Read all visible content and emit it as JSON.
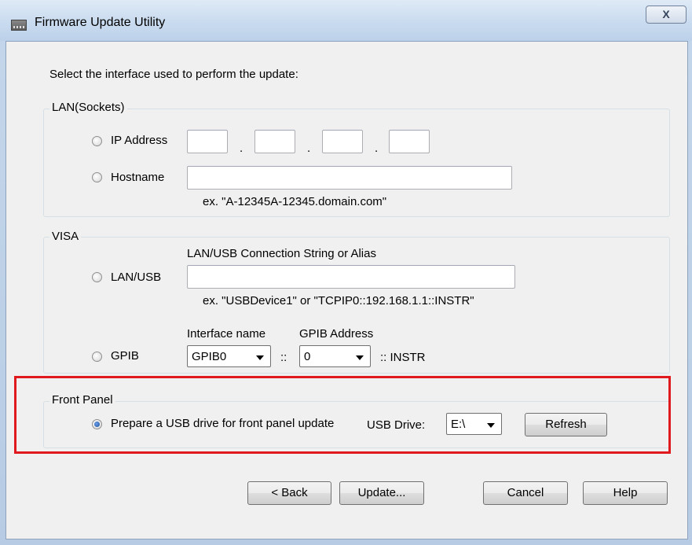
{
  "window": {
    "title": "Firmware Update Utility",
    "close_glyph": "X",
    "app_icon": "app-icon"
  },
  "instruction": "Select the interface used to perform the update:",
  "lan": {
    "group_label": "LAN(Sockets)",
    "ip_label": "IP Address",
    "ip_octets": [
      "",
      "",
      "",
      ""
    ],
    "ip_separator": ".",
    "hostname_label": "Hostname",
    "hostname_value": "",
    "hostname_example": "ex. \"A-12345A-12345.domain.com\""
  },
  "visa": {
    "group_label": "VISA",
    "conn_string_label": "LAN/USB Connection String or Alias",
    "lanusb_label": "LAN/USB",
    "lanusb_value": "",
    "lanusb_example": "ex. \"USBDevice1\" or \"TCPIP0::192.168.1.1::INSTR\"",
    "interface_name_label": "Interface name",
    "gpib_address_label": "GPIB Address",
    "gpib_label": "GPIB",
    "interface_value": "GPIB0",
    "separator": "::",
    "address_value": "0",
    "instr_suffix": ":: INSTR"
  },
  "front_panel": {
    "group_label": "Front Panel",
    "prepare_label": "Prepare a USB drive for front panel update",
    "prepare_checked": true,
    "usb_drive_label": "USB Drive:",
    "usb_drive_value": "E:\\",
    "refresh_label": "Refresh",
    "highlight_color": "#e0191f"
  },
  "footer": {
    "back_label": "< Back",
    "update_label": "Update...",
    "cancel_label": "Cancel",
    "help_label": "Help"
  }
}
